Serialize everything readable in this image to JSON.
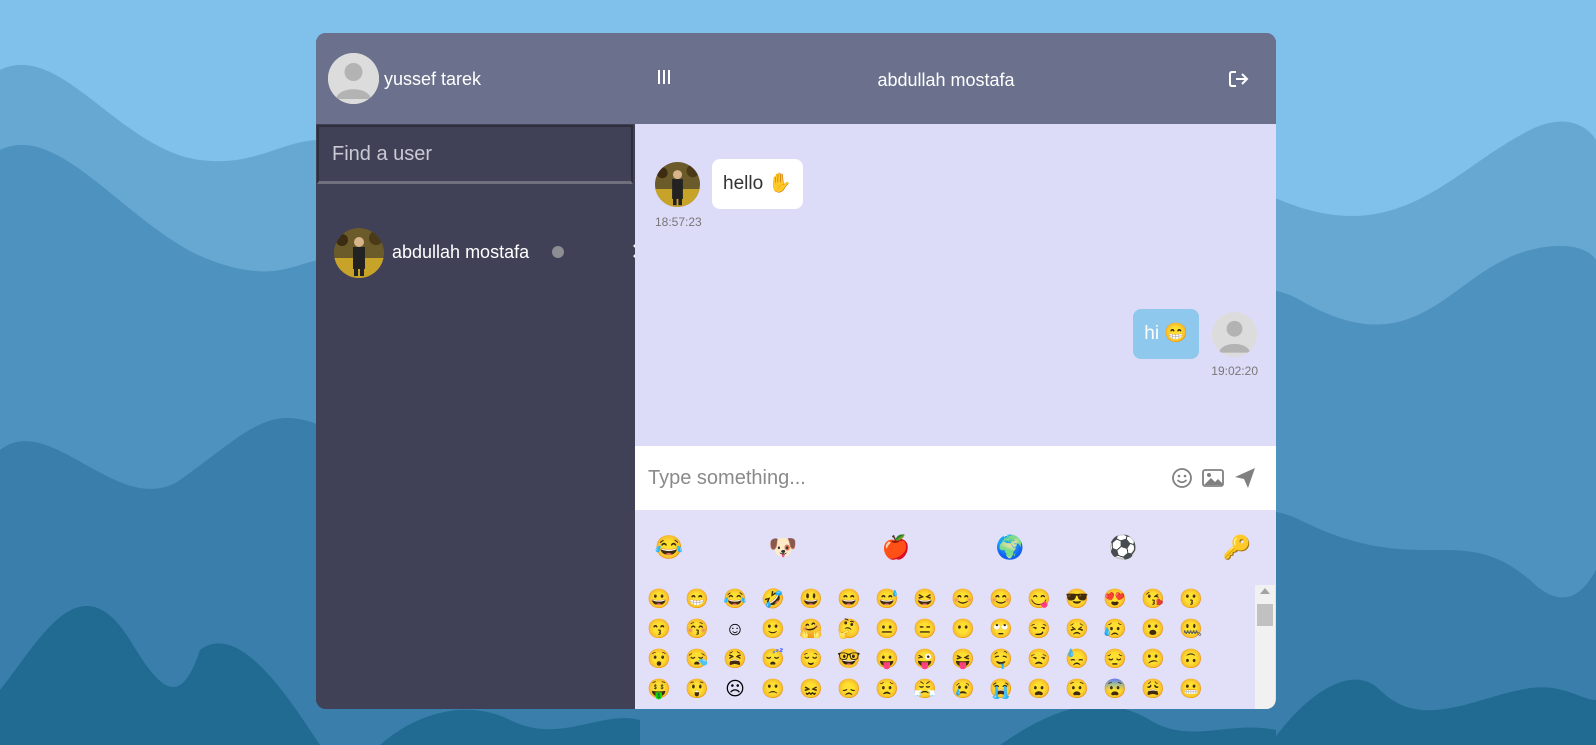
{
  "header": {
    "current_user_name": "yussef tarek",
    "chat_title": "abdullah mostafa",
    "menu_icon": "menu-bars-icon",
    "logout_icon": "logout-icon"
  },
  "sidebar": {
    "search_placeholder": "Find a user",
    "contacts": [
      {
        "name": "abdullah mostafa",
        "status": "offline",
        "close_icon": "close-icon"
      }
    ]
  },
  "messages": [
    {
      "direction": "incoming",
      "text": "hello ✋",
      "time": "18:57:23"
    },
    {
      "direction": "outgoing",
      "text": "hi 😁",
      "time": "19:02:20"
    }
  ],
  "composer": {
    "placeholder": "Type something...",
    "icons": [
      "emoji-icon",
      "image-icon",
      "send-icon"
    ]
  },
  "emoji_picker": {
    "categories": [
      "😂",
      "🐶",
      "🍎",
      "🌍",
      "⚽",
      "🔑"
    ],
    "rows": [
      [
        "😀",
        "😁",
        "😂",
        "🤣",
        "😃",
        "😄",
        "😅",
        "😆",
        "😊",
        "😊",
        "😋",
        "😎",
        "😍",
        "😘",
        "😗"
      ],
      [
        "😙",
        "😚",
        "☺",
        "🙂",
        "🤗",
        "🤔",
        "😐",
        "😑",
        "😶",
        "🙄",
        "😏",
        "😣",
        "😥",
        "😮",
        "🤐"
      ],
      [
        "😯",
        "😪",
        "😫",
        "😴",
        "😌",
        "🤓",
        "😛",
        "😜",
        "😝",
        "🤤",
        "😒",
        "😓",
        "😔",
        "😕",
        "🙃"
      ],
      [
        "🤑",
        "😲",
        "☹",
        "🙁",
        "😖",
        "😞",
        "😟",
        "😤",
        "😢",
        "😭",
        "😦",
        "😧",
        "😨",
        "😩",
        "😬"
      ]
    ]
  },
  "colors": {
    "header_bg": "#6b718c",
    "sidebar_bg": "#404156",
    "chat_bg": "#dddcf8",
    "outgoing_bubble": "#8ec8ec",
    "page_bg": "#7fc1ea"
  }
}
